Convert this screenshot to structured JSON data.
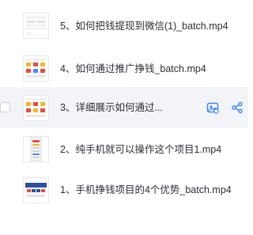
{
  "files": [
    {
      "name": "5、如何把钱提现到微信(1)_batch.mp4",
      "icon": "video-thumbnail-icon"
    },
    {
      "name": "4、如何通过推广挣钱_batch.mp4",
      "icon": "video-thumbnail-icon"
    },
    {
      "name": "3、详细展示如何通过...",
      "icon": "video-thumbnail-icon",
      "hover": true
    },
    {
      "name": "2、纯手机就可以操作这个项目1.mp4",
      "icon": "video-thumbnail-icon"
    },
    {
      "name": "1、手机挣钱项目的4个优势_batch.mp4",
      "icon": "video-thumbnail-icon"
    }
  ],
  "row_actions": {
    "save_icon": "save-to-drive-icon",
    "share_icon": "share-icon"
  },
  "colors": {
    "accent": "#3b82f6",
    "hover_bg": "#f2f4f7",
    "text": "#2b2f36"
  }
}
